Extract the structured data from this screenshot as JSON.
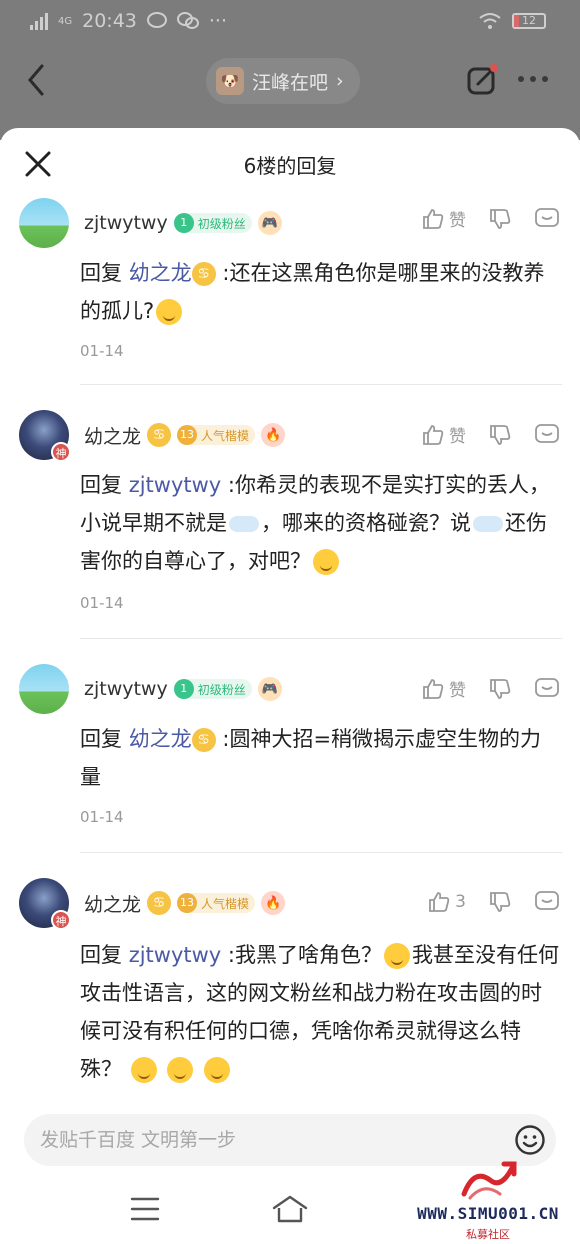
{
  "status_bar": {
    "network": "4G",
    "time": "20:43",
    "battery": "12"
  },
  "app_bar": {
    "forum_name": "汪峰在吧",
    "chevron": "›"
  },
  "sheet": {
    "title": "6楼的回复"
  },
  "replies": [
    {
      "username": "zjtwytwy",
      "level_num": "1",
      "level_label": "初级粉丝",
      "badge_icon": "game-icon",
      "like_label": "赞",
      "reply_prefix": "回复",
      "mention": "幼之龙",
      "text": ":还在这黑角色你是哪里来的没教养的孤儿?",
      "date": "01-14"
    },
    {
      "username": "幼之龙",
      "level_num": "13",
      "level_label": "人气楷模",
      "badge_icon": "fire-icon",
      "like_label": "赞",
      "reply_prefix": "回复",
      "mention": "zjtwytwy",
      "text_a": ":你希灵的表现不是实打实的丢人，小说早期不就是",
      "text_b": "，哪来的资格碰瓷？说",
      "text_c": "还伤害你的自尊心了，对吧？",
      "date": "01-14"
    },
    {
      "username": "zjtwytwy",
      "level_num": "1",
      "level_label": "初级粉丝",
      "badge_icon": "game-icon",
      "like_label": "赞",
      "reply_prefix": "回复",
      "mention": "幼之龙",
      "text": ":圆神大招=稍微揭示虚空生物的力量",
      "date": "01-14"
    },
    {
      "username": "幼之龙",
      "level_num": "13",
      "level_label": "人气楷模",
      "badge_icon": "fire-icon",
      "like_label": "3",
      "reply_prefix": "回复",
      "mention": "zjtwytwy",
      "text_a": ":我黑了啥角色？",
      "text_b": "我甚至没有任何攻击性语言，这的网文粉丝和战力粉在攻击圆的时候可没有积任何的口德，凭啥你希灵就得这么特殊？"
    }
  ],
  "avatar_badge": "神",
  "input": {
    "placeholder": "发贴千百度 文明第一步"
  },
  "watermark": {
    "text": "WWW.SIMU001.CN",
    "sub": "私募社区"
  },
  "colors": {
    "mention": "#4a5aa5",
    "overlay": "#7c7c7c",
    "level_green": "#38c48a",
    "level_gold": "#f0b13c"
  }
}
